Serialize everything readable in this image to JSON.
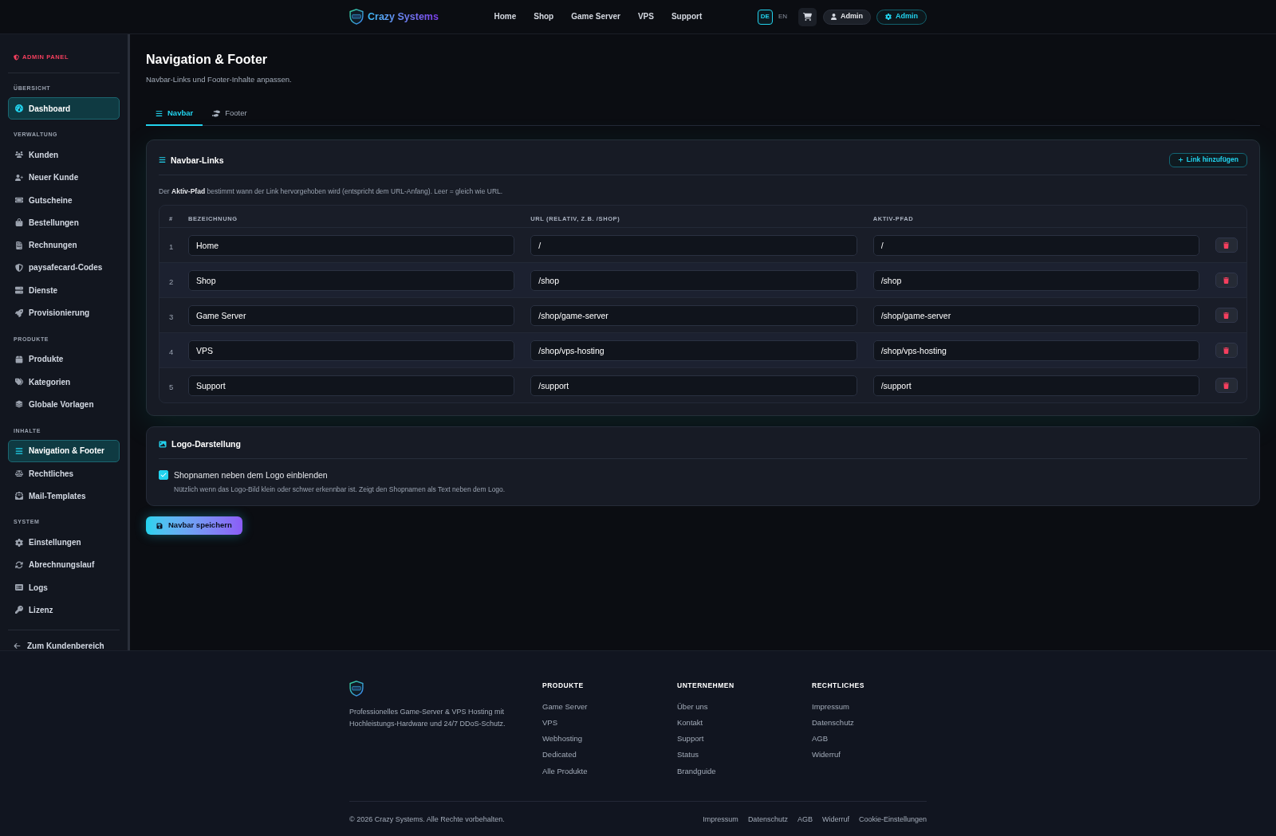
{
  "topbar": {
    "brand": "Crazy Systems",
    "nav_links": [
      "Home",
      "Shop",
      "Game Server",
      "VPS",
      "Support"
    ],
    "languages": [
      {
        "label": "DE",
        "selected": true
      },
      {
        "label": "EN",
        "selected": false
      }
    ],
    "account_button": "Admin",
    "admin_button": "Admin"
  },
  "sidebar": {
    "title": "ADMIN PANEL",
    "sections": [
      {
        "label": "ÜBERSICHT",
        "items": [
          {
            "label": "Dashboard",
            "selected": true
          }
        ]
      },
      {
        "label": "VERWALTUNG",
        "items": [
          {
            "label": "Kunden",
            "selected": false
          },
          {
            "label": "Neuer Kunde",
            "selected": false
          },
          {
            "label": "Gutscheine",
            "selected": false
          },
          {
            "label": "Bestellungen",
            "selected": false
          },
          {
            "label": "Rechnungen",
            "selected": false
          },
          {
            "label": "paysafecard-Codes",
            "selected": false
          },
          {
            "label": "Dienste",
            "selected": false
          },
          {
            "label": "Provisionierung",
            "selected": false
          }
        ]
      },
      {
        "label": "PRODUKTE",
        "items": [
          {
            "label": "Produkte",
            "selected": false
          },
          {
            "label": "Kategorien",
            "selected": false
          },
          {
            "label": "Globale Vorlagen",
            "selected": false
          }
        ]
      },
      {
        "label": "INHALTE",
        "items": [
          {
            "label": "Navigation & Footer",
            "selected": true
          },
          {
            "label": "Rechtliches",
            "selected": false
          },
          {
            "label": "Mail-Templates",
            "selected": false
          }
        ]
      },
      {
        "label": "SYSTEM",
        "items": [
          {
            "label": "Einstellungen",
            "selected": false
          },
          {
            "label": "Abrechnungslauf",
            "selected": false
          },
          {
            "label": "Logs",
            "selected": false
          },
          {
            "label": "Lizenz",
            "selected": false
          }
        ]
      }
    ],
    "back_link": "Zum Kundenbereich"
  },
  "page": {
    "title": "Navigation & Footer",
    "subtitle": "Navbar-Links und Footer-Inhalte anpassen."
  },
  "tabs": [
    {
      "label": "Navbar",
      "selected": true
    },
    {
      "label": "Footer",
      "selected": false
    }
  ],
  "navbar_links_card": {
    "title": "Navbar-Links",
    "add_button": "Link hinzufügen",
    "description": "Der **Aktiv-Pfad** bestimmt wann der Link hervorgehoben wird (entspricht dem URL-Anfang). Leer = gleich wie URL.",
    "table": {
      "columns": [
        "#",
        "BEZEICHNUNG",
        "URL (RELATIV, Z.B. /SHOP)",
        "AKTIV-PFAD"
      ],
      "rows": [
        {
          "index": "1",
          "label": "Home",
          "url": "/",
          "active_path": "/"
        },
        {
          "index": "2",
          "label": "Shop",
          "url": "/shop",
          "active_path": "/shop"
        },
        {
          "index": "3",
          "label": "Game Server",
          "url": "/shop/game-server",
          "active_path": "/shop/game-server"
        },
        {
          "index": "4",
          "label": "VPS",
          "url": "/shop/vps-hosting",
          "active_path": "/shop/vps-hosting"
        },
        {
          "index": "5",
          "label": "Support",
          "url": "/support",
          "active_path": "/support"
        }
      ]
    }
  },
  "logo_card": {
    "title": "Logo-Darstellung",
    "checkbox": {
      "label": "Shopnamen neben dem Logo einblenden",
      "checked": true
    },
    "hint": "Nützlich wenn das Logo-Bild klein oder schwer erkennbar ist. Zeigt den Shopnamen als Text neben dem Logo."
  },
  "save_button": "Navbar speichern",
  "footer": {
    "description": "Professionelles Game-Server & VPS Hosting mit Hochleistungs-Hardware und 24/7 DDoS-Schutz.",
    "columns": [
      {
        "title": "PRODUKTE",
        "links": [
          "Game Server",
          "VPS",
          "Webhosting",
          "Dedicated",
          "Alle Produkte"
        ]
      },
      {
        "title": "UNTERNEHMEN",
        "links": [
          "Über uns",
          "Kontakt",
          "Support",
          "Status",
          "Brandguide"
        ]
      },
      {
        "title": "RECHTLICHES",
        "links": [
          "Impressum",
          "Datenschutz",
          "AGB",
          "Widerruf"
        ]
      }
    ],
    "copyright": "© 2026 Crazy Systems. Alle Rechte vorbehalten.",
    "bottom_links": [
      "Impressum",
      "Datenschutz",
      "AGB",
      "Widerruf",
      "Cookie-Einstellungen"
    ]
  }
}
